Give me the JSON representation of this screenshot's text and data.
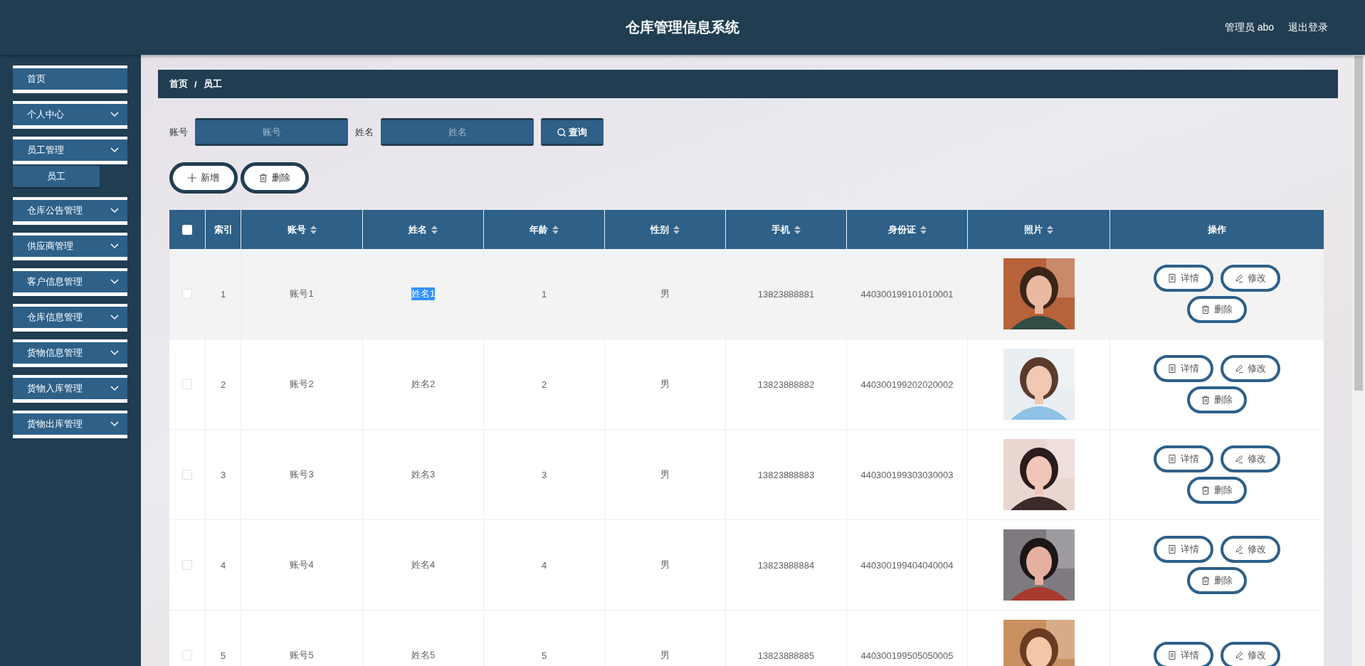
{
  "header": {
    "title": "仓库管理信息系统",
    "user": "管理员 abo",
    "logout": "退出登录"
  },
  "sidebar": {
    "items": [
      {
        "label": "首页",
        "kind": "link"
      },
      {
        "label": "个人中心",
        "kind": "group"
      },
      {
        "label": "员工管理",
        "kind": "group",
        "children": [
          {
            "label": "员工"
          }
        ]
      },
      {
        "label": "仓库公告管理",
        "kind": "group"
      },
      {
        "label": "供应商管理",
        "kind": "group"
      },
      {
        "label": "客户信息管理",
        "kind": "group"
      },
      {
        "label": "仓库信息管理",
        "kind": "group"
      },
      {
        "label": "货物信息管理",
        "kind": "group"
      },
      {
        "label": "货物入库管理",
        "kind": "group"
      },
      {
        "label": "货物出库管理",
        "kind": "group"
      }
    ]
  },
  "breadcrumb": {
    "items": [
      "首页",
      "员工"
    ],
    "separator": "/"
  },
  "search": {
    "fields": [
      {
        "label": "账号",
        "placeholder": "账号"
      },
      {
        "label": "姓名",
        "placeholder": "姓名"
      }
    ],
    "button": "查询"
  },
  "toolbar": [
    {
      "label": "新增",
      "kind": "add"
    },
    {
      "label": "删除",
      "kind": "delete"
    }
  ],
  "table": {
    "header_checked": false,
    "columns": [
      {
        "label": "索引",
        "sortable": false
      },
      {
        "label": "账号",
        "sortable": true
      },
      {
        "label": "姓名",
        "sortable": true
      },
      {
        "label": "年龄",
        "sortable": true
      },
      {
        "label": "性别",
        "sortable": true
      },
      {
        "label": "手机",
        "sortable": true
      },
      {
        "label": "身份证",
        "sortable": true
      },
      {
        "label": "照片",
        "sortable": true
      },
      {
        "label": "操作",
        "sortable": false
      }
    ],
    "rows": [
      {
        "checked": false,
        "hovered": true,
        "name_selected": true,
        "cells": [
          "1",
          "账号1",
          "姓名1",
          "1",
          "男",
          "13823888881",
          "440300199101010001"
        ],
        "photo": {
          "kind": "picture"
        },
        "actions": [
          {
            "label": "详情",
            "kind": "detail"
          },
          {
            "label": "修改",
            "kind": "edit"
          },
          {
            "label": "删除",
            "kind": "delete"
          }
        ]
      },
      {
        "checked": false,
        "hovered": false,
        "name_selected": false,
        "cells": [
          "2",
          "账号2",
          "姓名2",
          "2",
          "男",
          "13823888882",
          "440300199202020002"
        ],
        "photo": {
          "kind": "picture"
        },
        "actions": [
          {
            "label": "详情",
            "kind": "detail"
          },
          {
            "label": "修改",
            "kind": "edit"
          },
          {
            "label": "删除",
            "kind": "delete"
          }
        ]
      },
      {
        "checked": false,
        "hovered": false,
        "name_selected": false,
        "cells": [
          "3",
          "账号3",
          "姓名3",
          "3",
          "男",
          "13823888883",
          "440300199303030003"
        ],
        "photo": {
          "kind": "picture"
        },
        "actions": [
          {
            "label": "详情",
            "kind": "detail"
          },
          {
            "label": "修改",
            "kind": "edit"
          },
          {
            "label": "删除",
            "kind": "delete"
          }
        ]
      },
      {
        "checked": false,
        "hovered": false,
        "name_selected": false,
        "cells": [
          "4",
          "账号4",
          "姓名4",
          "4",
          "男",
          "13823888884",
          "440300199404040004"
        ],
        "photo": {
          "kind": "picture"
        },
        "actions": [
          {
            "label": "详情",
            "kind": "detail"
          },
          {
            "label": "修改",
            "kind": "edit"
          },
          {
            "label": "删除",
            "kind": "delete"
          }
        ]
      },
      {
        "checked": false,
        "hovered": false,
        "name_selected": false,
        "cells": [
          "5",
          "账号5",
          "姓名5",
          "5",
          "男",
          "13823888885",
          "440300199505050005"
        ],
        "photo": {
          "kind": "picture"
        },
        "actions": [
          {
            "label": "详情",
            "kind": "detail"
          },
          {
            "label": "修改",
            "kind": "edit"
          }
        ]
      }
    ]
  }
}
